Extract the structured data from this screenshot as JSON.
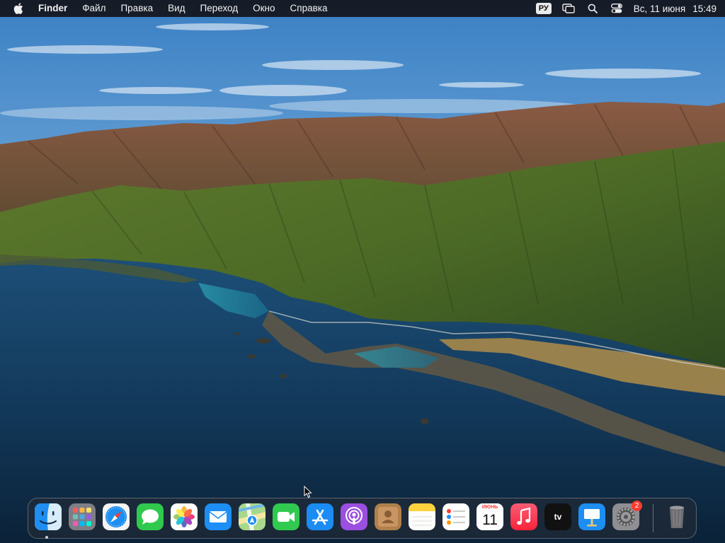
{
  "menubar": {
    "apple_icon": "apple-logo",
    "items": [
      "Finder",
      "Файл",
      "Правка",
      "Вид",
      "Переход",
      "Окно",
      "Справка"
    ],
    "input_source": "РУ",
    "status_icons": [
      "screen-mirroring-icon",
      "search-icon",
      "control-center-icon"
    ],
    "date": "Вс, 11 июня",
    "time": "15:49"
  },
  "dock": {
    "apps": [
      {
        "name": "Finder",
        "icon": "finder-icon",
        "running": true
      },
      {
        "name": "Launchpad",
        "icon": "launchpad-icon",
        "running": false
      },
      {
        "name": "Safari",
        "icon": "safari-icon",
        "running": false
      },
      {
        "name": "Messages",
        "icon": "messages-icon",
        "running": false
      },
      {
        "name": "Photos",
        "icon": "photos-icon",
        "running": false
      },
      {
        "name": "Mail",
        "icon": "mail-icon",
        "running": false
      },
      {
        "name": "Maps",
        "icon": "maps-icon",
        "running": false
      },
      {
        "name": "FaceTime",
        "icon": "facetime-icon",
        "running": false
      },
      {
        "name": "App Store",
        "icon": "app-store-icon",
        "running": false
      },
      {
        "name": "Podcasts",
        "icon": "podcasts-icon",
        "running": false
      },
      {
        "name": "Contacts",
        "icon": "contacts-icon",
        "running": false
      },
      {
        "name": "Notes",
        "icon": "notes-icon",
        "running": false
      },
      {
        "name": "Reminders",
        "icon": "reminders-icon",
        "running": false
      },
      {
        "name": "Calendar",
        "icon": "calendar-icon",
        "running": false
      },
      {
        "name": "Music",
        "icon": "music-icon",
        "running": false
      },
      {
        "name": "TV",
        "icon": "tv-icon",
        "running": false
      },
      {
        "name": "Keynote",
        "icon": "keynote-icon",
        "running": false
      },
      {
        "name": "System Preferences",
        "icon": "system-preferences-icon",
        "running": false
      }
    ],
    "calendar": {
      "month": "ИЮНЬ",
      "day": "11"
    },
    "tv_label": "tv",
    "system_preferences_badge": "2",
    "trash": {
      "name": "Trash",
      "icon": "trash-icon"
    }
  },
  "wallpaper": {
    "description_icon": "big-sur-coast-wallpaper"
  },
  "colors": {
    "menubar_bg": "#12141a",
    "badge": "#ff3b30",
    "accent": "#0a84ff"
  }
}
